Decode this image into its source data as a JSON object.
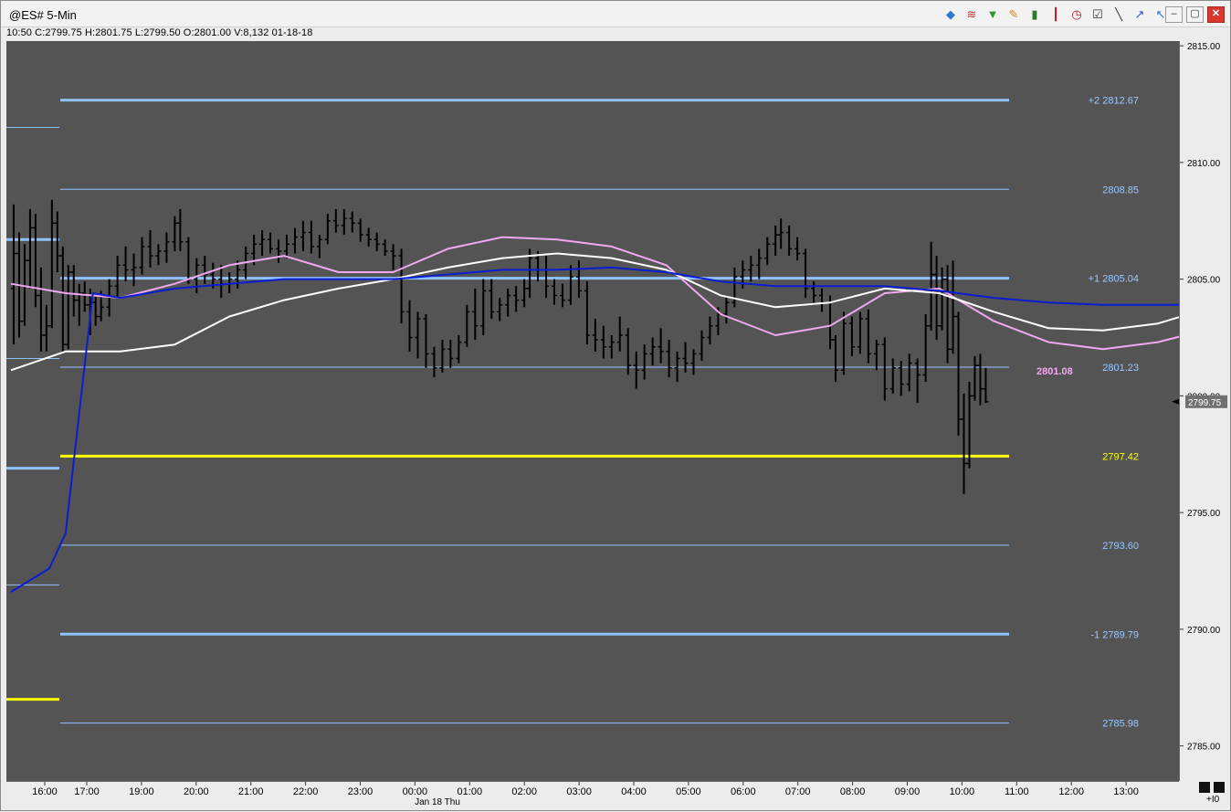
{
  "window": {
    "title": "@ES# 5-Min",
    "info": "10:50  C:2799.75  H:2801.75  L:2799.50  O:2801.00  V:8,132  01-18-18",
    "toolbar_icons": [
      "cube-icon",
      "waves-icon",
      "funnel-icon",
      "pencil-icon",
      "bar-chart-icon",
      "candlestick-icon",
      "clock-icon",
      "checklist-icon",
      "line-tool-icon",
      "trend-icon",
      "cursor-icon"
    ],
    "window_buttons": {
      "minimize": "–",
      "restore": "▢",
      "close": "✕"
    },
    "corner_label": "+I0"
  },
  "colors": {
    "plot_bg": "#545454",
    "bars": "#000000",
    "band_line": "#8fc3ff",
    "mid_line": "#ffff00",
    "vwap_blue": "#0a1ed0",
    "pink_ma": "#f0a8f0",
    "white_ma": "#ffffff",
    "last_price_bg": "#707070"
  },
  "chart_data": {
    "type": "line",
    "ylim": [
      2783.5,
      2815.2
    ],
    "y_ticks": [
      "2815.00",
      "2810.00",
      "2805.00",
      "2800.00",
      "2795.00",
      "2790.00",
      "2785.00"
    ],
    "x_ticks": [
      "16:00",
      "17:00",
      "19:00",
      "20:00",
      "21:00",
      "22:00",
      "23:00",
      "00:00",
      "01:00",
      "02:00",
      "03:00",
      "04:00",
      "05:00",
      "06:00",
      "07:00",
      "08:00",
      "09:00",
      "10:00",
      "11:00",
      "12:00",
      "13:00"
    ],
    "x_date_label": "Jan 18 Thu",
    "bands": [
      {
        "label": "+2 2812.67",
        "value": 2812.67,
        "style": "thick"
      },
      {
        "label": "2808.85",
        "value": 2808.85,
        "style": "thin"
      },
      {
        "label": "+1 2805.04",
        "value": 2805.04,
        "style": "thick"
      },
      {
        "label": "2801.23",
        "value": 2801.23,
        "style": "thin"
      },
      {
        "label": "2797.42",
        "value": 2797.42,
        "style": "mid"
      },
      {
        "label": "2793.60",
        "value": 2793.6,
        "style": "thin"
      },
      {
        "label": "-1 2789.79",
        "value": 2789.79,
        "style": "thick"
      },
      {
        "label": "2785.98",
        "value": 2785.98,
        "style": "thin"
      }
    ],
    "prior_levels": [
      2811.5,
      2806.7,
      2801.6,
      2796.9,
      2791.9,
      2787.0
    ],
    "ma_label": "2801.08",
    "last_price": "2799.75",
    "last_value": 2799.75,
    "series": [
      {
        "name": "",
        "color": "pink",
        "x": [
          0,
          1,
          2,
          3,
          4,
          5,
          6,
          7,
          8,
          9,
          10,
          11,
          12,
          13,
          14,
          15,
          16,
          17,
          18,
          19,
          20,
          21,
          22,
          23,
          24,
          25,
          26,
          27,
          28,
          29,
          30,
          31,
          32,
          33,
          34,
          35,
          36
        ],
        "values": [
          2804.8,
          2804.4,
          2804.2,
          2804.8,
          2805.6,
          2806.0,
          2805.3,
          2805.3,
          2806.3,
          2806.8,
          2806.7,
          2806.4,
          2805.6,
          2803.5,
          2802.6,
          2803.0,
          2804.4,
          2804.6,
          2803.2,
          2802.3,
          2802.0,
          2802.3,
          2802.9,
          2804.6,
          2805.3,
          2804.2,
          2802.6,
          2802.0,
          2801.4,
          2801.9,
          2801.1,
          2801.08,
          2801.08,
          2801.08,
          2801.08,
          2801.08,
          2801.08
        ],
        "ma_x_end": 30.8
      },
      {
        "name": "",
        "color": "white",
        "x": [
          0,
          1,
          2,
          3,
          4,
          5,
          6,
          7,
          8,
          9,
          10,
          11,
          12,
          13,
          14,
          15,
          16,
          17,
          18,
          19,
          20,
          21,
          22,
          23,
          24,
          25,
          26,
          27,
          28,
          29,
          30,
          31
        ],
        "values": [
          2801.1,
          2801.9,
          2801.9,
          2802.2,
          2803.4,
          2804.1,
          2804.6,
          2805.0,
          2805.5,
          2805.9,
          2806.1,
          2805.9,
          2805.4,
          2804.3,
          2803.8,
          2804.0,
          2804.6,
          2804.4,
          2803.6,
          2802.9,
          2802.8,
          2803.1,
          2803.8,
          2804.6,
          2804.3,
          2803.5,
          2802.5,
          2802.1,
          2801.9,
          2801.7,
          2801.5,
          2801.4
        ]
      },
      {
        "name": "",
        "color": "blue",
        "x": [
          0,
          0.7,
          1,
          1.5,
          2,
          3,
          4,
          5,
          6,
          7,
          8,
          9,
          10,
          11,
          12,
          13,
          14,
          15,
          16,
          17,
          18,
          19,
          20,
          21,
          22,
          23,
          24,
          25,
          26,
          27,
          28,
          29,
          30,
          30.5
        ],
        "values": [
          2791.6,
          2792.6,
          2794.1,
          2804.4,
          2804.2,
          2804.6,
          2804.8,
          2805.0,
          2805.0,
          2805.0,
          2805.2,
          2805.4,
          2805.4,
          2805.5,
          2805.3,
          2804.9,
          2804.7,
          2804.7,
          2804.7,
          2804.5,
          2804.2,
          2804.0,
          2803.9,
          2803.9,
          2803.9,
          2803.9,
          2803.9,
          2803.8,
          2803.7,
          2803.4,
          2802.7,
          2802.6,
          2802.4,
          2802.4
        ]
      }
    ],
    "bars_note": "5-min OHLC bars, approximate shape",
    "ohlc_bars": [
      [
        0.05,
        2804.6,
        2808.2,
        2802.2,
        2806.1
      ],
      [
        0.15,
        2806.1,
        2807.0,
        2802.5,
        2803.2
      ],
      [
        0.25,
        2803.2,
        2806.5,
        2803.0,
        2805.8
      ],
      [
        0.35,
        2805.8,
        2808.0,
        2804.6,
        2807.2
      ],
      [
        0.45,
        2807.2,
        2807.8,
        2803.8,
        2804.3
      ],
      [
        0.55,
        2804.3,
        2805.5,
        2801.9,
        2802.6
      ],
      [
        0.65,
        2802.6,
        2803.9,
        2801.9,
        2803.0
      ],
      [
        0.75,
        2803.0,
        2808.4,
        2802.9,
        2807.4
      ],
      [
        0.85,
        2807.4,
        2807.9,
        2805.3,
        2806.0
      ],
      [
        0.95,
        2806.0,
        2806.4,
        2801.9,
        2802.2
      ],
      [
        1.05,
        2802.2,
        2805.6,
        2802.0,
        2805.3
      ],
      [
        1.15,
        2805.3,
        2805.6,
        2803.4,
        2804.1
      ],
      [
        1.25,
        2804.1,
        2804.8,
        2803.0,
        2804.4
      ],
      [
        1.35,
        2804.4,
        2804.9,
        2803.6,
        2803.9
      ],
      [
        1.45,
        2803.9,
        2804.6,
        2802.6,
        2804.0
      ],
      [
        1.55,
        2804.0,
        2804.3,
        2803.0,
        2803.4
      ],
      [
        1.65,
        2803.4,
        2804.5,
        2803.2,
        2803.8
      ],
      [
        1.8,
        2803.8,
        2805.0,
        2803.4,
        2804.7
      ],
      [
        1.95,
        2804.7,
        2806.0,
        2804.2,
        2805.6
      ],
      [
        2.1,
        2805.6,
        2806.4,
        2804.9,
        2805.4
      ],
      [
        2.25,
        2805.4,
        2806.1,
        2804.7,
        2805.5
      ],
      [
        2.4,
        2805.5,
        2806.8,
        2805.2,
        2806.4
      ],
      [
        2.55,
        2806.4,
        2807.1,
        2805.5,
        2806.0
      ],
      [
        2.7,
        2806.0,
        2806.5,
        2805.6,
        2806.2
      ],
      [
        2.85,
        2806.2,
        2807.0,
        2805.7,
        2806.6
      ],
      [
        3.0,
        2806.6,
        2807.7,
        2806.2,
        2807.4
      ],
      [
        3.1,
        2807.4,
        2808.0,
        2806.2,
        2806.6
      ],
      [
        3.25,
        2806.6,
        2806.8,
        2804.8,
        2805.0
      ],
      [
        3.4,
        2805.0,
        2805.9,
        2804.4,
        2805.6
      ],
      [
        3.55,
        2805.6,
        2806.0,
        2804.8,
        2805.2
      ],
      [
        3.7,
        2805.2,
        2805.7,
        2804.6,
        2805.0
      ],
      [
        3.85,
        2805.0,
        2805.6,
        2804.2,
        2804.8
      ],
      [
        4.0,
        2804.8,
        2805.3,
        2804.4,
        2805.0
      ],
      [
        4.15,
        2805.0,
        2805.8,
        2804.6,
        2805.4
      ],
      [
        4.3,
        2805.4,
        2806.4,
        2805.0,
        2806.1
      ],
      [
        4.45,
        2806.1,
        2806.9,
        2805.6,
        2806.5
      ],
      [
        4.6,
        2806.5,
        2807.1,
        2806.0,
        2806.7
      ],
      [
        4.75,
        2806.7,
        2807.0,
        2806.1,
        2806.3
      ],
      [
        4.9,
        2806.3,
        2806.7,
        2805.7,
        2806.2
      ],
      [
        5.05,
        2806.2,
        2806.9,
        2805.9,
        2806.5
      ],
      [
        5.2,
        2806.5,
        2807.2,
        2806.1,
        2806.8
      ],
      [
        5.35,
        2806.8,
        2807.5,
        2806.2,
        2807.0
      ],
      [
        5.5,
        2807.0,
        2807.5,
        2806.1,
        2806.4
      ],
      [
        5.65,
        2806.4,
        2806.9,
        2805.9,
        2806.7
      ],
      [
        5.8,
        2806.7,
        2807.8,
        2806.5,
        2807.5
      ],
      [
        5.95,
        2807.5,
        2808.0,
        2807.0,
        2807.3
      ],
      [
        6.1,
        2807.3,
        2808.0,
        2806.9,
        2807.6
      ],
      [
        6.25,
        2807.6,
        2807.9,
        2807.0,
        2807.4
      ],
      [
        6.4,
        2807.4,
        2807.6,
        2806.6,
        2806.9
      ],
      [
        6.55,
        2806.9,
        2807.2,
        2806.4,
        2806.7
      ],
      [
        6.7,
        2806.7,
        2807.0,
        2806.2,
        2806.5
      ],
      [
        6.85,
        2806.5,
        2806.7,
        2806.0,
        2806.2
      ],
      [
        7.0,
        2806.2,
        2806.5,
        2805.4,
        2806.0
      ],
      [
        7.15,
        2806.0,
        2806.3,
        2803.1,
        2803.6
      ],
      [
        7.3,
        2803.6,
        2804.1,
        2801.9,
        2802.5
      ],
      [
        7.45,
        2802.5,
        2803.6,
        2801.6,
        2803.3
      ],
      [
        7.6,
        2803.3,
        2803.5,
        2801.2,
        2801.8
      ],
      [
        7.75,
        2801.8,
        2802.1,
        2800.8,
        2801.2
      ],
      [
        7.9,
        2801.2,
        2802.4,
        2801.0,
        2802.0
      ],
      [
        8.05,
        2802.0,
        2802.4,
        2801.2,
        2801.6
      ],
      [
        8.2,
        2801.6,
        2802.6,
        2801.4,
        2802.3
      ],
      [
        8.35,
        2802.3,
        2803.9,
        2802.1,
        2803.6
      ],
      [
        8.5,
        2803.6,
        2804.6,
        2802.4,
        2803.0
      ],
      [
        8.65,
        2803.0,
        2805.0,
        2802.6,
        2804.5
      ],
      [
        8.8,
        2804.5,
        2805.0,
        2803.3,
        2803.6
      ],
      [
        8.95,
        2803.6,
        2804.2,
        2803.2,
        2803.9
      ],
      [
        9.1,
        2803.9,
        2804.6,
        2803.4,
        2804.3
      ],
      [
        9.25,
        2804.3,
        2804.7,
        2803.6,
        2804.1
      ],
      [
        9.4,
        2804.1,
        2805.0,
        2803.8,
        2804.6
      ],
      [
        9.5,
        2804.6,
        2806.3,
        2804.2,
        2805.9
      ],
      [
        9.65,
        2805.9,
        2806.2,
        2804.9,
        2805.4
      ],
      [
        9.8,
        2805.4,
        2806.0,
        2804.2,
        2804.7
      ],
      [
        9.95,
        2804.7,
        2805.0,
        2803.9,
        2804.3
      ],
      [
        10.1,
        2804.3,
        2804.8,
        2803.8,
        2804.1
      ],
      [
        10.25,
        2804.1,
        2805.6,
        2803.9,
        2805.1
      ],
      [
        10.4,
        2805.1,
        2805.8,
        2804.2,
        2804.5
      ],
      [
        10.55,
        2804.5,
        2804.9,
        2802.2,
        2802.6
      ],
      [
        10.7,
        2802.6,
        2803.3,
        2801.9,
        2802.4
      ],
      [
        10.85,
        2802.4,
        2803.0,
        2801.6,
        2802.1
      ],
      [
        11.0,
        2802.1,
        2802.6,
        2801.6,
        2802.3
      ],
      [
        11.15,
        2802.3,
        2803.4,
        2801.9,
        2802.6
      ],
      [
        11.3,
        2802.6,
        2802.9,
        2800.9,
        2801.3
      ],
      [
        11.45,
        2801.3,
        2801.9,
        2800.3,
        2801.1
      ],
      [
        11.6,
        2801.1,
        2802.2,
        2800.7,
        2801.8
      ],
      [
        11.75,
        2801.8,
        2802.5,
        2801.3,
        2802.1
      ],
      [
        11.9,
        2802.1,
        2802.9,
        2801.4,
        2801.9
      ],
      [
        12.05,
        2801.9,
        2802.4,
        2800.8,
        2801.2
      ],
      [
        12.2,
        2801.2,
        2801.9,
        2800.6,
        2801.6
      ],
      [
        12.35,
        2801.6,
        2802.3,
        2801.0,
        2801.4
      ],
      [
        12.5,
        2801.4,
        2802.0,
        2800.9,
        2801.8
      ],
      [
        12.65,
        2801.8,
        2802.8,
        2801.5,
        2802.5
      ],
      [
        12.8,
        2802.5,
        2803.4,
        2802.2,
        2803.0
      ],
      [
        12.95,
        2803.0,
        2803.8,
        2802.6,
        2803.5
      ],
      [
        13.1,
        2803.5,
        2804.3,
        2803.1,
        2804.0
      ],
      [
        13.25,
        2804.0,
        2805.5,
        2803.8,
        2805.1
      ],
      [
        13.4,
        2805.1,
        2805.8,
        2804.6,
        2805.4
      ],
      [
        13.55,
        2805.4,
        2806.0,
        2804.9,
        2805.6
      ],
      [
        13.7,
        2805.6,
        2806.3,
        2805.0,
        2805.9
      ],
      [
        13.85,
        2805.9,
        2806.8,
        2805.6,
        2806.5
      ],
      [
        14.0,
        2806.5,
        2807.3,
        2806.0,
        2806.9
      ],
      [
        14.1,
        2806.9,
        2807.6,
        2806.3,
        2807.0
      ],
      [
        14.25,
        2807.0,
        2807.3,
        2806.0,
        2806.3
      ],
      [
        14.4,
        2806.3,
        2806.8,
        2805.8,
        2806.1
      ],
      [
        14.55,
        2806.1,
        2806.3,
        2804.2,
        2804.6
      ],
      [
        14.7,
        2804.6,
        2804.9,
        2803.9,
        2804.3
      ],
      [
        14.85,
        2804.3,
        2804.6,
        2803.6,
        2804.0
      ],
      [
        15.0,
        2804.0,
        2804.3,
        2802.0,
        2802.4
      ],
      [
        15.1,
        2802.4,
        2802.6,
        2800.6,
        2801.1
      ],
      [
        15.25,
        2801.1,
        2803.6,
        2800.9,
        2803.1
      ],
      [
        15.4,
        2803.1,
        2803.4,
        2801.7,
        2802.1
      ],
      [
        15.55,
        2802.1,
        2803.6,
        2801.8,
        2803.3
      ],
      [
        15.7,
        2803.3,
        2803.7,
        2801.4,
        2801.8
      ],
      [
        15.85,
        2801.8,
        2802.4,
        2801.1,
        2802.2
      ],
      [
        16.0,
        2802.2,
        2802.5,
        2799.8,
        2800.3
      ],
      [
        16.15,
        2800.3,
        2801.6,
        2800.1,
        2801.2
      ],
      [
        16.3,
        2801.2,
        2801.5,
        2800.0,
        2800.5
      ],
      [
        16.45,
        2800.5,
        2801.8,
        2800.2,
        2801.4
      ],
      [
        16.6,
        2801.4,
        2801.6,
        2799.7,
        2800.9
      ],
      [
        16.75,
        2800.9,
        2803.5,
        2800.6,
        2803.0
      ],
      [
        16.85,
        2803.0,
        2806.6,
        2802.8,
        2805.2
      ],
      [
        16.95,
        2805.2,
        2806.0,
        2802.4,
        2803.0
      ],
      [
        17.05,
        2803.0,
        2805.5,
        2802.8,
        2805.0
      ],
      [
        17.15,
        2805.0,
        2805.6,
        2801.4,
        2802.0
      ],
      [
        17.25,
        2802.0,
        2805.8,
        2801.8,
        2803.4
      ],
      [
        17.35,
        2803.4,
        2803.6,
        2798.3,
        2799.0
      ],
      [
        17.45,
        2799.0,
        2800.1,
        2795.8,
        2797.1
      ],
      [
        17.55,
        2797.1,
        2800.6,
        2796.9,
        2800.0
      ],
      [
        17.65,
        2800.0,
        2801.7,
        2799.8,
        2801.3
      ],
      [
        17.75,
        2801.3,
        2801.8,
        2799.6,
        2800.3
      ],
      [
        17.85,
        2800.3,
        2801.2,
        2799.7,
        2799.75
      ]
    ]
  }
}
